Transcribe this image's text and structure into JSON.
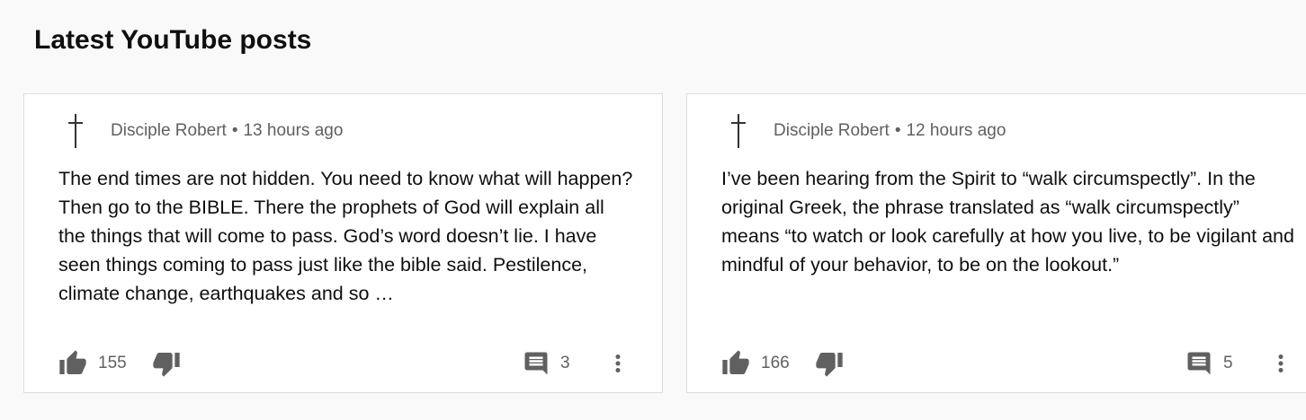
{
  "section": {
    "title": "Latest YouTube posts"
  },
  "posts": [
    {
      "author": "Disciple Robert",
      "separator": "•",
      "time": "13 hours ago",
      "text": "The end times are not hidden. You need to know what will happen? Then go to the BIBLE. There the prophets of God will explain all the things that will come to pass. God’s word doesn’t lie. I have seen things coming to pass just like the bible said. Pestilence, climate change, earthquakes and so …",
      "likes": "155",
      "comments": "3"
    },
    {
      "author": "Disciple Robert",
      "separator": "•",
      "time": "12 hours ago",
      "text": "I’ve been hearing from the Spirit to “walk circumspectly”. In the original Greek, the phrase translated as “walk circumspectly” means “to watch or look carefully at how you live, to be vigilant and mindful of your behavior, to be on the lookout.”",
      "likes": "166",
      "comments": "5"
    }
  ],
  "icons": {
    "avatar": "cross-icon",
    "like": "thumb-up-icon",
    "dislike": "thumb-down-icon",
    "comment": "comment-icon",
    "more": "more-vert-icon"
  },
  "colors": {
    "page_bg": "#f9f9f9",
    "card_bg": "#ffffff",
    "text": "#0f0f0f",
    "secondary_text": "#606060",
    "icon": "#606060"
  }
}
